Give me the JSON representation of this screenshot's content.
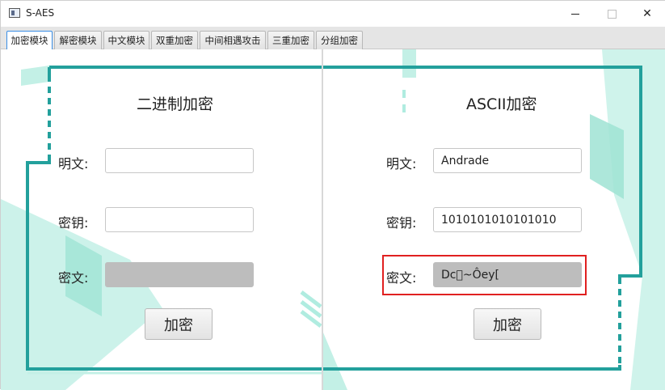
{
  "window": {
    "title": "S-AES"
  },
  "tabs": [
    "加密模块",
    "解密模块",
    "中文模块",
    "双重加密",
    "中间相遇攻击",
    "三重加密",
    "分组加密"
  ],
  "binary_panel": {
    "heading": "二进制加密",
    "plaintext_label": "明文:",
    "plaintext_value": "",
    "key_label": "密钥:",
    "key_value": "",
    "ciphertext_label": "密文:",
    "ciphertext_value": "",
    "encrypt_button": "加密"
  },
  "ascii_panel": {
    "heading": "ASCII加密",
    "plaintext_label": "明文:",
    "plaintext_value": "Andrade",
    "key_label": "密钥:",
    "key_value": "1010101010101010",
    "ciphertext_label": "密文:",
    "ciphertext_value": "Dc\u0000~Ôey[",
    "encrypt_button": "加密"
  },
  "colors": {
    "teal_frame": "#23a09c",
    "mint_deco": "#b9eee3",
    "highlight": "#e02020"
  }
}
